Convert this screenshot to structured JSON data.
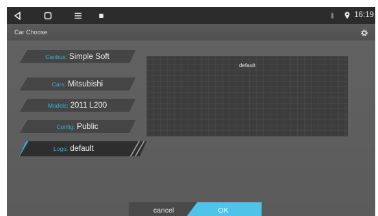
{
  "status_bar": {
    "time": "16:19",
    "icons": [
      "back-icon",
      "home-icon",
      "menu-icon",
      "notification-icon",
      "bluetooth-icon",
      "location-icon"
    ]
  },
  "title_bar": {
    "title": "Car Choose",
    "settings_icon": "gear-icon"
  },
  "fields": {
    "candbus": {
      "label": "Canbus:",
      "value": "Simple Soft"
    },
    "cars": {
      "label": "Cars:",
      "value": "Mitsubishi"
    },
    "models": {
      "label": "Models:",
      "value": "2011 L200"
    },
    "config": {
      "label": "Config:",
      "value": "Public"
    },
    "logo": {
      "label": "Logo:",
      "value": "default"
    }
  },
  "preview": {
    "text": "default"
  },
  "buttons": {
    "cancel": "cancel",
    "ok": "OK"
  },
  "colors": {
    "accent": "#2fb3d6",
    "ok_button": "#4fc3e8",
    "background": "#5d5d5d",
    "status_bar": "#2c2c2c"
  }
}
